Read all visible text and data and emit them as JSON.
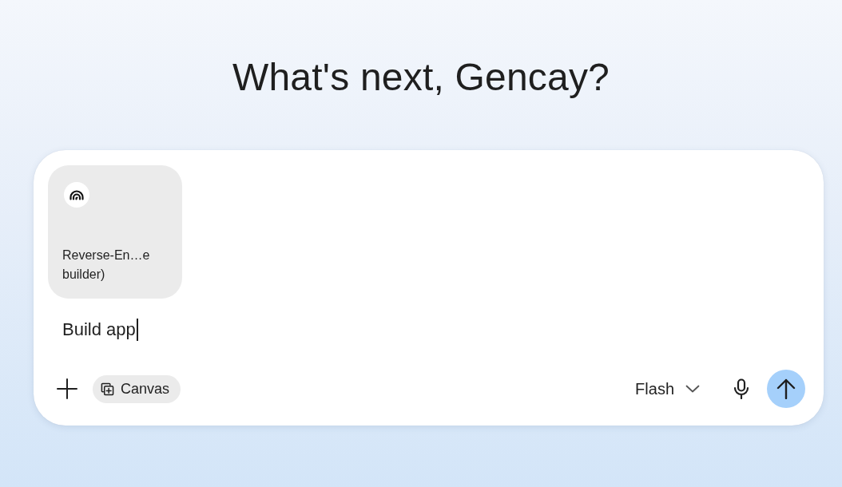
{
  "heading": "What's next, Gencay?",
  "attachment": {
    "name": "Reverse-En…e builder)"
  },
  "prompt": {
    "value": "Build app",
    "focused": true
  },
  "toolbar": {
    "tools": [
      {
        "label": "Canvas"
      }
    ],
    "model": "Flash"
  }
}
